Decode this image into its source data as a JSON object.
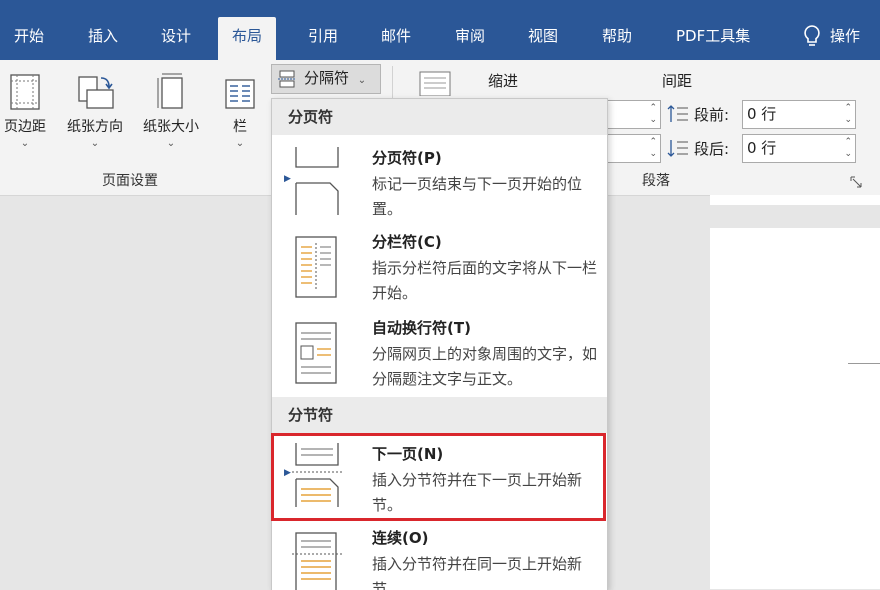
{
  "tabs": [
    {
      "label": "开始"
    },
    {
      "label": "插入"
    },
    {
      "label": "设计"
    },
    {
      "label": "布局",
      "active": true
    },
    {
      "label": "引用"
    },
    {
      "label": "邮件"
    },
    {
      "label": "审阅"
    },
    {
      "label": "视图"
    },
    {
      "label": "帮助"
    },
    {
      "label": "PDF工具集"
    },
    {
      "label": "操作"
    }
  ],
  "ribbon": {
    "page_setup": {
      "group_label": "页面设置",
      "margins": "页边距",
      "orientation": "纸张方向",
      "size": "纸张大小",
      "columns": "栏"
    },
    "breaks_button": "分隔符",
    "indent": {
      "header": "缩进"
    },
    "spacing": {
      "header": "间距",
      "before_label": "段前:",
      "before_value": "0 行",
      "after_label": "段后:",
      "after_value": "0 行"
    },
    "paragraph_group_label": "段落"
  },
  "breaks_menu": {
    "page_breaks_header": "分页符",
    "section_breaks_header": "分节符",
    "items": [
      {
        "title": "分页符(P)",
        "desc": "标记一页结束与下一页开始的位置。"
      },
      {
        "title": "分栏符(C)",
        "desc": "指示分栏符后面的文字将从下一栏开始。"
      },
      {
        "title": "自动换行符(T)",
        "desc": "分隔网页上的对象周围的文字，如分隔题注文字与正文。"
      },
      {
        "title": "下一页(N)",
        "desc": "插入分节符并在下一页上开始新节。",
        "highlighted": true
      },
      {
        "title": "连续(O)",
        "desc": "插入分节符并在同一页上开始新节。"
      }
    ]
  },
  "colors": {
    "accent": "#2b5797",
    "highlight": "#d9262c",
    "icon_orange": "#e5a33c"
  }
}
